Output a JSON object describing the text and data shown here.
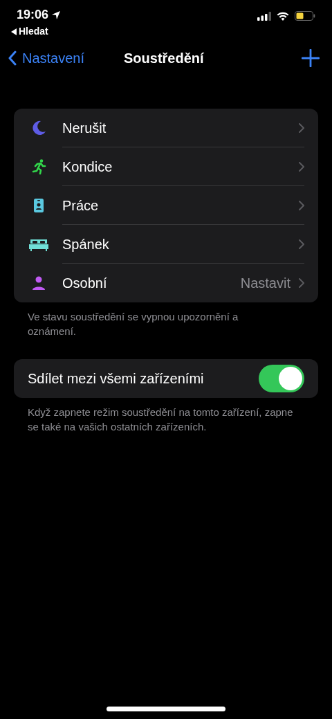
{
  "status_bar": {
    "time": "19:06",
    "back_app": "Hledat"
  },
  "nav": {
    "back": "Nastavení",
    "title": "Soustředění"
  },
  "focus_modes": [
    {
      "kind": "moon",
      "color": "#5e5ce6",
      "label": "Nerušit"
    },
    {
      "kind": "runner",
      "color": "#32d74b",
      "label": "Kondice"
    },
    {
      "kind": "badge",
      "color": "#5ac8e0",
      "label": "Práce"
    },
    {
      "kind": "bed",
      "color": "#70e0d8",
      "label": "Spánek"
    },
    {
      "kind": "person",
      "color": "#bf5af2",
      "label": "Osobní",
      "value": "Nastavit"
    }
  ],
  "focus_footer": "Ve stavu soustředění se vypnou upozornění a oznámení.",
  "share": {
    "label": "Sdílet mezi všemi zařízeními",
    "on": true
  },
  "share_footer": "Když zapnete režim soustředění na tomto zařízení, zapne se také na vašich ostatních zařízeních."
}
